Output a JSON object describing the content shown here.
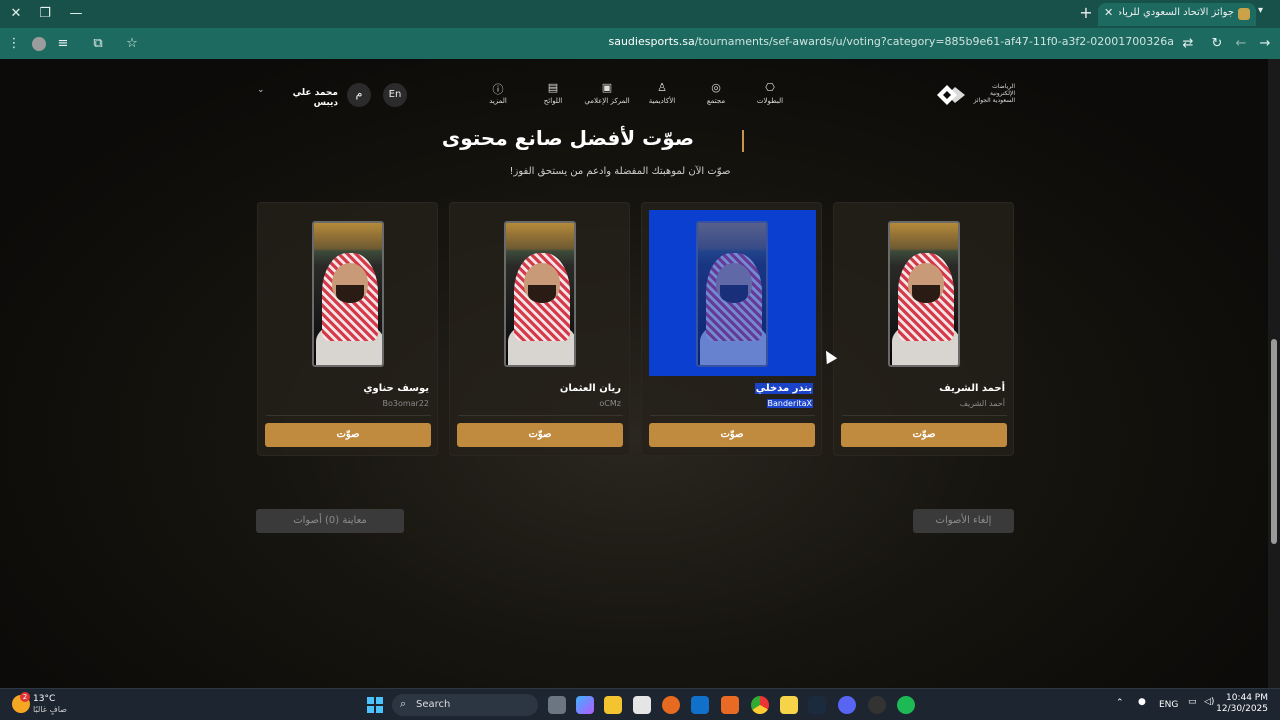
{
  "browser": {
    "tab_title": "جوائز الاتحاد السعودي للرياضات الإلكترونية",
    "url_host": "saudiesports.sa",
    "url_path": "/tournaments/sef-awards/u/voting?category=885b9e61-af47-11f0-a3f2-02001700326a"
  },
  "nav": {
    "logo_text": "الرياضات الإلكترونية السعودية الجوائز",
    "items": [
      {
        "label": "البطولات",
        "icon": "controller-icon"
      },
      {
        "label": "مجتمع",
        "icon": "community-icon"
      },
      {
        "label": "الأكاديمية",
        "icon": "academy-icon"
      },
      {
        "label": "المركز الإعلامي",
        "icon": "media-icon"
      },
      {
        "label": "اللوائح",
        "icon": "rules-icon"
      },
      {
        "label": "المزيد",
        "icon": "more-icon"
      }
    ],
    "lang": "En",
    "avatar_initial": "م",
    "username": "محمد علي ديبس"
  },
  "section": {
    "title": "صوّت لأفضل صانع محتوى",
    "subtitle": "صوّت الآن لموهبتك المفضلة وادعم من يستحق الفوز!"
  },
  "candidates": [
    {
      "name": "أحمد الشريف",
      "handle": "أحمد الشريف",
      "vote_label": "صوّت"
    },
    {
      "name": "بندر مدخلي",
      "handle": "BanderitaX",
      "vote_label": "صوّت",
      "selected": true
    },
    {
      "name": "ريان العثمان",
      "handle": "oCMz",
      "vote_label": "صوّت"
    },
    {
      "name": "يوسف حناوي",
      "handle": "Bo3omar22",
      "vote_label": "صوّت"
    }
  ],
  "actions": {
    "review_label": "معاينة (0) أصوات",
    "cancel_label": "إلغاء الأصوات"
  },
  "taskbar": {
    "temperature": "13°C",
    "condition": "صافٍ غالبًا",
    "weather_badge": "2",
    "search_label": "Search",
    "lang": "ENG",
    "time": "10:44 PM",
    "date": "12/30/2025"
  },
  "colors": {
    "accent": "#c08b3f",
    "browser": "#1d6a60",
    "selection": "#0b3fcf"
  }
}
